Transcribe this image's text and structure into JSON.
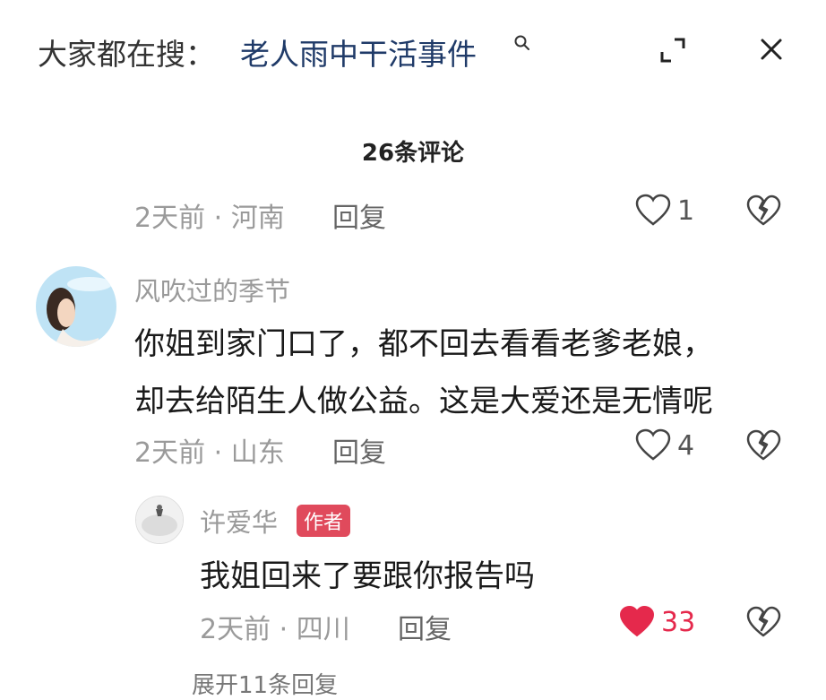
{
  "header": {
    "search_prefix": "大家都在搜：",
    "search_query": "老人雨中干活事件",
    "icons": [
      "search-icon",
      "expand-icon",
      "close-icon"
    ]
  },
  "comments_title": "26条评论",
  "comment0": {
    "time": "2天前",
    "location": "河南",
    "reply_label": "回复",
    "likes": "1"
  },
  "comment1": {
    "username": "风吹过的季节",
    "line1": "你姐到家门口了，都不回去看看老爹老娘，",
    "line2": "却去给陌生人做公益。这是大爱还是无情呢",
    "time": "2天前",
    "location": "山东",
    "reply_label": "回复",
    "likes": "4"
  },
  "reply1": {
    "username": "许爱华",
    "badge": "作者",
    "text": "我姐回来了要跟你报告吗",
    "time": "2天前",
    "location": "四川",
    "reply_label": "回复",
    "likes": "33",
    "liked": true,
    "like_color": "#e5294c"
  },
  "expand_replies": "展开11条回复",
  "colors": {
    "accent": "#e5294c",
    "badge": "#e04a5c",
    "query": "#1f3a68"
  }
}
